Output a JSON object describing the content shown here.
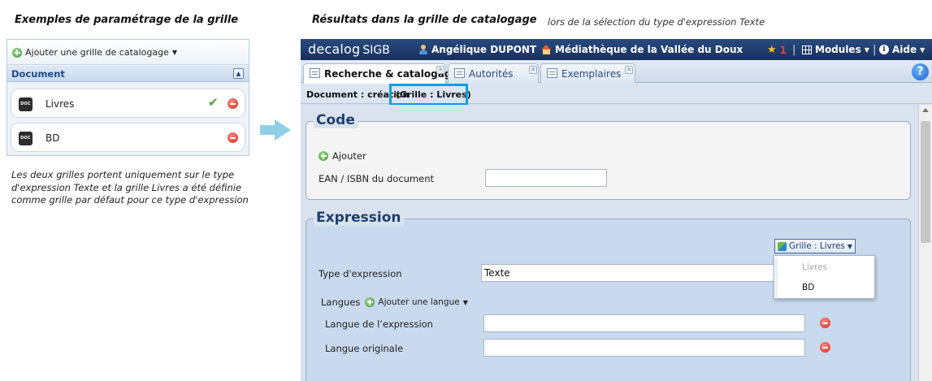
{
  "captions": {
    "left_title": "Exemples de paramétrage de la grille",
    "right_title": "Résultats dans la grille de catalogage",
    "right_subtitle": "lors de la sélection du type d'expression Texte",
    "note_line1": "Les deux grilles portent uniquement sur le type",
    "note_line2": "d'expression Texte et la grille Livres a été définie",
    "note_line3": "comme grille par défaut pour ce type d'expression"
  },
  "left_panel": {
    "add_label": "Ajouter une grille de catalogage",
    "section_label": "Document",
    "items": [
      {
        "icon_text": "DOC",
        "label": "Livres",
        "is_default": true
      },
      {
        "icon_text": "DOC",
        "label": "BD",
        "is_default": false
      }
    ]
  },
  "app": {
    "brand": "decalog",
    "brand_suffix": "SIGB",
    "user": "Angélique DUPONT",
    "library": "Médiathèque de la Vallée du Doux",
    "notif_count": "1",
    "modules": "Modules",
    "aide": "Aide",
    "tabs": [
      {
        "label": "Recherche & catalogage",
        "active": true
      },
      {
        "label": "Autorités",
        "active": false
      },
      {
        "label": "Exemplaires",
        "active": false
      }
    ],
    "breadcrumb": "Document : création",
    "breadcrumb_grille": "(Grille : Livres)",
    "code_section": {
      "title": "Code",
      "add_label": "Ajouter",
      "ean_label": "EAN / ISBN du document",
      "ean_value": ""
    },
    "expression_section": {
      "title": "Expression",
      "grille_button": "Grille : Livres",
      "grille_options": [
        "Livres",
        "BD"
      ],
      "type_label": "Type d'expression",
      "type_value": "Texte",
      "langues_label": "Langues",
      "add_langue": "Ajouter une langue",
      "langue_expression_label": "Langue de l’expression",
      "langue_originale_label": "Langue originale"
    }
  },
  "colors": {
    "topbar": "#16305d",
    "highlight": "#0a9ee0",
    "arrow": "#8fd0e8",
    "section_title": "#1d3f6e"
  }
}
